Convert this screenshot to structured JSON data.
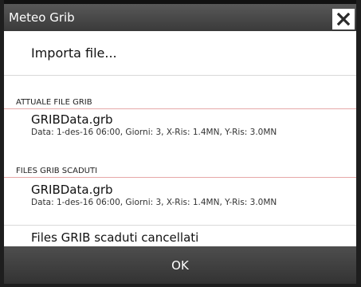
{
  "dialog": {
    "title": "Meteo Grib",
    "close_icon": "close-icon"
  },
  "import": {
    "label": "Importa file..."
  },
  "current_section": {
    "header": "ATTUALE FILE GRIB",
    "file": {
      "name": "GRIBData.grb",
      "details": "Data: 1-des-16 06:00, Giorni: 3, X-Ris: 1.4MN, Y-Ris: 3.0MN"
    }
  },
  "expired_section": {
    "header": "FILES GRIB SCADUTI",
    "file": {
      "name": "GRIBData.grb",
      "details": "Data: 1-des-16 06:00, Giorni: 3, X-Ris: 1.4MN, Y-Ris: 3.0MN"
    },
    "delete_label": "Files GRIB scaduti cancellati"
  },
  "ok_button": {
    "label": "OK"
  }
}
